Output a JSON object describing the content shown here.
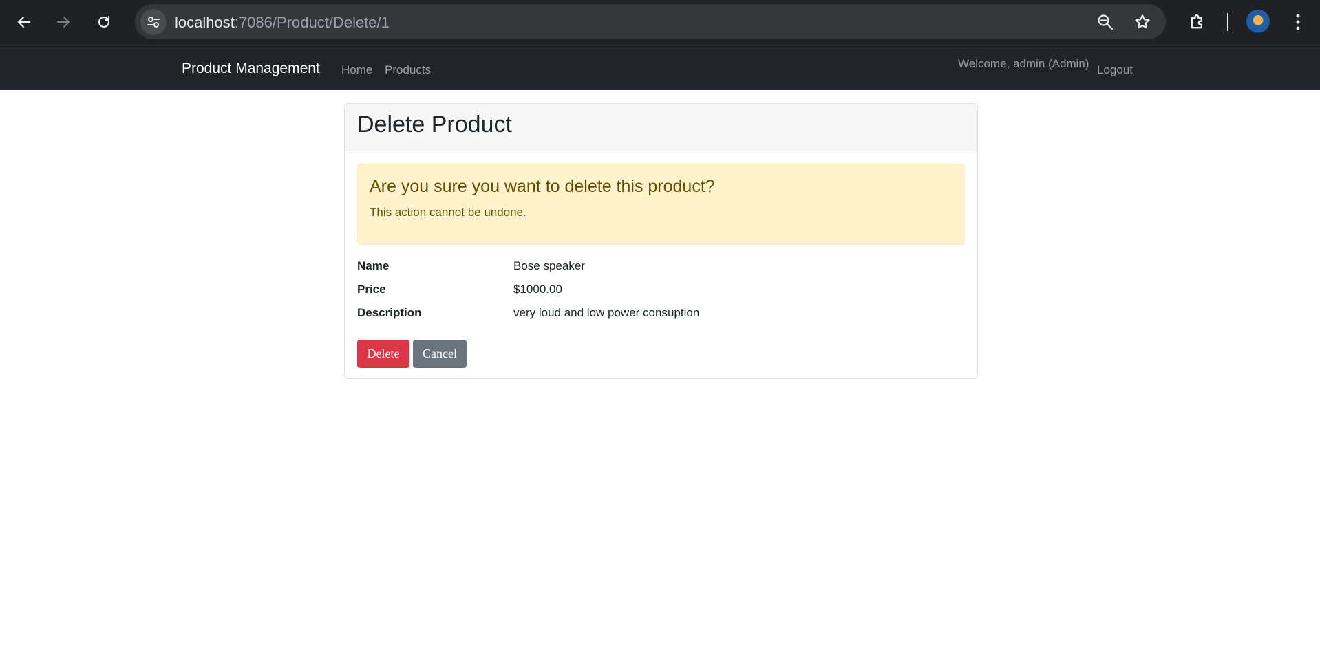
{
  "browser": {
    "url_host": "localhost",
    "url_path": ":7086/Product/Delete/1"
  },
  "navbar": {
    "brand": "Product Management",
    "links": [
      "Home",
      "Products"
    ],
    "welcome": "Welcome, admin (Admin)",
    "logout": "Logout"
  },
  "card": {
    "title": "Delete Product",
    "alert": {
      "heading": "Are you sure you want to delete this product?",
      "text": "This action cannot be undone."
    },
    "details": [
      {
        "label": "Name",
        "value": "Bose speaker"
      },
      {
        "label": "Price",
        "value": "$1000.00"
      },
      {
        "label": "Description",
        "value": "very loud and low power consuption"
      }
    ],
    "buttons": {
      "delete": "Delete",
      "cancel": "Cancel"
    }
  },
  "colors": {
    "navbar_bg": "#212529",
    "alert_bg": "#fff3cd",
    "alert_text": "#664d03",
    "danger": "#dc3545",
    "secondary": "#6c757d"
  }
}
